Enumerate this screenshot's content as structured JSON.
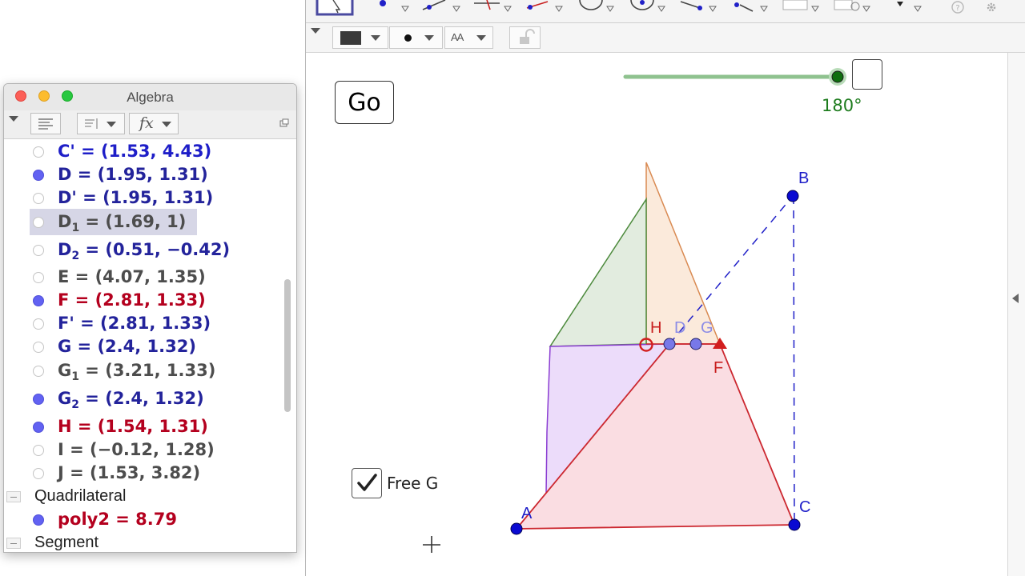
{
  "algebra": {
    "title": "Algebra",
    "rows": [
      {
        "text": "C' = (1.53, 4.43)",
        "color": "#1e1ec8",
        "dot": "empty"
      },
      {
        "text": "D = (1.95, 1.31)",
        "color": "#23239b",
        "dot": "filled"
      },
      {
        "text": "D' = (1.95, 1.31)",
        "color": "#23239b",
        "dot": "empty"
      },
      {
        "name": "D",
        "sub": "1",
        "value": " = (1.69, 1)",
        "color": "#4d4d4d",
        "dot": "empty",
        "selected": true
      },
      {
        "name": "D",
        "sub": "2",
        "value": " = (0.51, −0.42)",
        "color": "#23239b",
        "dot": "empty"
      },
      {
        "text": "E = (4.07, 1.35)",
        "color": "#4d4d4d",
        "dot": "empty"
      },
      {
        "text": "F = (2.81, 1.33)",
        "color": "#b4001e",
        "dot": "filled"
      },
      {
        "text": "F' = (2.81, 1.33)",
        "color": "#23239b",
        "dot": "empty"
      },
      {
        "text": "G = (2.4, 1.32)",
        "color": "#23239b",
        "dot": "empty"
      },
      {
        "name": "G",
        "sub": "1",
        "value": " = (3.21, 1.33)",
        "color": "#4d4d4d",
        "dot": "empty"
      },
      {
        "name": "G",
        "sub": "2",
        "value": " = (2.4, 1.32)",
        "color": "#23239b",
        "dot": "filled"
      },
      {
        "text": "H = (1.54, 1.31)",
        "color": "#b4001e",
        "dot": "filled"
      },
      {
        "text": "I = (−0.12, 1.28)",
        "color": "#4d4d4d",
        "dot": "empty"
      },
      {
        "text": "J = (1.53, 3.82)",
        "color": "#4d4d4d",
        "dot": "empty"
      }
    ],
    "section_quadrilateral": "Quadrilateral",
    "poly_row": {
      "text": "poly2 = 8.79",
      "color": "#b4001e",
      "dot": "filled"
    },
    "section_segment": "Segment",
    "fx_label": "fx"
  },
  "graphics": {
    "go_button": "Go",
    "slider_value": "180°",
    "slider_level": 1.0,
    "free_g_label": "Free G",
    "free_g_checked": true,
    "point_labels": {
      "A": "A",
      "B": "B",
      "C": "C",
      "D": "D",
      "F": "F",
      "G": "G",
      "H": "H"
    }
  },
  "stylebar": {
    "text_size_icon": "AA"
  },
  "colors": {
    "slider": "#1e7c1e",
    "point_blue": "#0a0ad2",
    "red": "#c81e1e",
    "purple_fill": "#e8d8fa",
    "pink_fill": "#fadde2",
    "orange_fill": "#fbeadb",
    "green_fill": "#e2ecdf"
  }
}
